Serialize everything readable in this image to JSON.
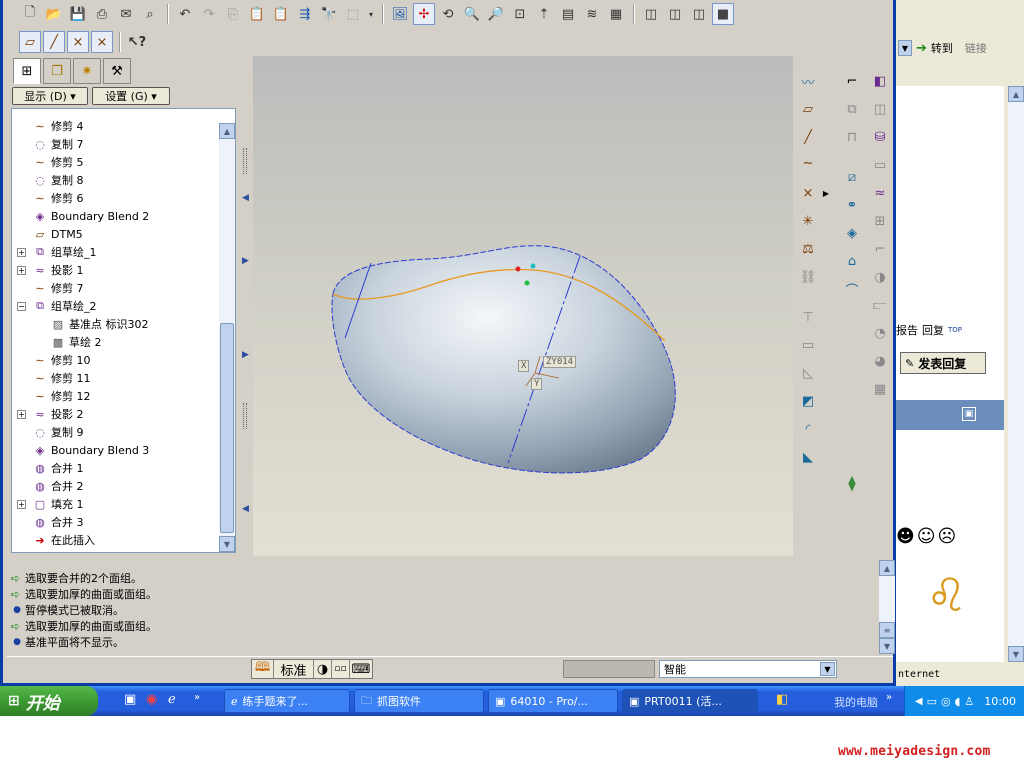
{
  "toolbar": {
    "row1_icons": [
      "new-file-icon",
      "open-folder-icon",
      "save-icon",
      "print-icon",
      "email-icon",
      "email-link-icon",
      "undo-icon",
      "redo-icon",
      "copy-icon",
      "paste-icon",
      "paste-special-icon",
      "regenerate-icon",
      "find-icon",
      "select-box-icon",
      "repaint-icon",
      "spin-center-icon",
      "orient-icon",
      "zoom-in-icon",
      "zoom-out-icon",
      "refit-icon",
      "reorient-icon",
      "view-manager-icon",
      "layers-icon",
      "saved-views-icon",
      "wireframe-icon",
      "hidden-line-icon",
      "no-hidden-icon",
      "shading-icon"
    ],
    "row2_icons": [
      "datum-plane-display-icon",
      "datum-axis-display-icon",
      "point-display-icon",
      "csys-display-icon",
      "context-help-icon"
    ]
  },
  "tree": {
    "tabs": [
      "model-tree-tab",
      "layer-tree-tab",
      "favorites-tab",
      "tools-tab"
    ],
    "show_label": "显示 (D) ▾",
    "settings_label": "设置 (G) ▾",
    "items": [
      {
        "label": "修剪 4",
        "icon": "trim-icon",
        "expand": ""
      },
      {
        "label": "复制 7",
        "icon": "copy-surface-icon",
        "expand": ""
      },
      {
        "label": "修剪 5",
        "icon": "trim-icon",
        "expand": ""
      },
      {
        "label": "复制 8",
        "icon": "copy-surface-icon",
        "expand": ""
      },
      {
        "label": "修剪 6",
        "icon": "trim-icon",
        "expand": ""
      },
      {
        "label": "Boundary Blend 2",
        "icon": "boundary-blend-icon",
        "expand": ""
      },
      {
        "label": "DTM5",
        "icon": "datum-plane-icon",
        "expand": ""
      },
      {
        "label": "组草绘_1",
        "icon": "group-icon",
        "expand": "+"
      },
      {
        "label": "投影 1",
        "icon": "projection-icon",
        "expand": "+"
      },
      {
        "label": "修剪 7",
        "icon": "trim-icon",
        "expand": ""
      },
      {
        "label": "组草绘_2",
        "icon": "group-icon",
        "expand": "−"
      },
      {
        "label": "基准点 标识302",
        "icon": "datum-point-icon",
        "expand": "",
        "indent": 1
      },
      {
        "label": "草绘 2",
        "icon": "sketch-icon",
        "expand": "",
        "indent": 1
      },
      {
        "label": "修剪 10",
        "icon": "trim-icon",
        "expand": ""
      },
      {
        "label": "修剪 11",
        "icon": "trim-icon",
        "expand": ""
      },
      {
        "label": "修剪 12",
        "icon": "trim-icon",
        "expand": ""
      },
      {
        "label": "投影 2",
        "icon": "projection-icon",
        "expand": "+"
      },
      {
        "label": "复制 9",
        "icon": "copy-surface-icon",
        "expand": ""
      },
      {
        "label": "Boundary Blend 3",
        "icon": "boundary-blend-icon",
        "expand": ""
      },
      {
        "label": "合并 1",
        "icon": "merge-icon",
        "expand": ""
      },
      {
        "label": "合并 2",
        "icon": "merge-icon",
        "expand": ""
      },
      {
        "label": "填充 1",
        "icon": "fill-icon",
        "expand": "+"
      },
      {
        "label": "合并 3",
        "icon": "merge-icon",
        "expand": ""
      },
      {
        "label": "在此插入",
        "icon": "insert-here-arrow-icon",
        "expand": ""
      }
    ]
  },
  "graphics": {
    "datum_tag": "ZY014",
    "datum_x_tag": "X",
    "datum_y_tag": "Y"
  },
  "messages": [
    {
      "icon": "green-arrow-icon",
      "text": "选取要合并的2个面组。"
    },
    {
      "icon": "green-arrow-icon",
      "text": "选取要加厚的曲面或面组。"
    },
    {
      "icon": "blue-dot-icon",
      "text": "暂停模式已被取消。"
    },
    {
      "icon": "green-arrow-icon",
      "text": "选取要加厚的曲面或面组。"
    },
    {
      "icon": "blue-dot-icon",
      "text": "基准平面将不显示。"
    }
  ],
  "status": {
    "std_label": "标准",
    "filter_value": "智能"
  },
  "browser": {
    "goto_label": "转到",
    "links_label": "链接",
    "report_label": "报告",
    "reply_label": "回复",
    "top_label": "TOP",
    "post_reply_label": "发表回复",
    "zone_label": "nternet"
  },
  "taskbar": {
    "start_label": "开始",
    "tasks": [
      {
        "label": "练手题来了...",
        "icon": "ie-icon"
      },
      {
        "label": "抓图软件",
        "icon": "folder-icon"
      },
      {
        "label": "64010 - Pro/...",
        "icon": "proe-icon"
      },
      {
        "label": "PRT0011 (活...",
        "icon": "proe-icon"
      }
    ],
    "my_computer": "我的电脑",
    "clock": "10:00"
  },
  "watermark": "www.meiyadesign.com",
  "colors": {
    "xp_blue": "#245edc",
    "start_green": "#3c9a32",
    "datum_line": "#2a3ad0",
    "trace_curve": "#e89a20",
    "watermark_red": "#d22020"
  }
}
